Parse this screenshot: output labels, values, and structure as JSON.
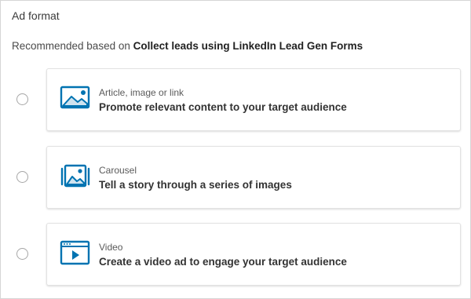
{
  "section": {
    "title": "Ad format",
    "recommend_prefix": "Recommended based on ",
    "recommend_objective": "Collect leads using LinkedIn Lead Gen Forms"
  },
  "options": [
    {
      "title": "Article, image or link",
      "description": "Promote relevant content to your target audience",
      "icon": "image-icon",
      "selected": false
    },
    {
      "title": "Carousel",
      "description": "Tell a story through a series of images",
      "icon": "carousel-icon",
      "selected": false
    },
    {
      "title": "Video",
      "description": "Create a video ad to engage your target audience",
      "icon": "video-icon",
      "selected": false
    }
  ],
  "colors": {
    "icon_stroke": "#0073b1",
    "icon_fill": "#cfe3ef",
    "icon_dot": "#0073b1"
  }
}
